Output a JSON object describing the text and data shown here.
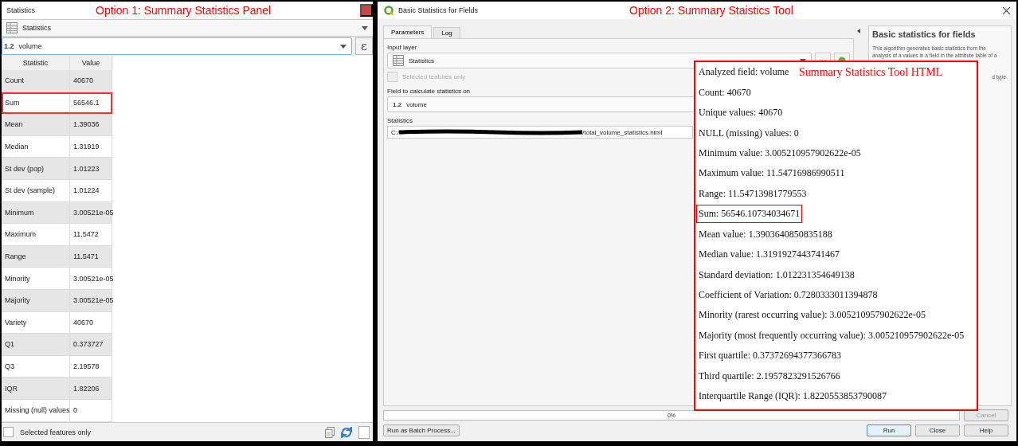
{
  "annotations": {
    "panel_label": "Option 1: Summary Statistics Panel",
    "tool_label": "Option 2: Summary Staistics Tool",
    "html_label": "Summary Statistics Tool HTML"
  },
  "statistics_panel": {
    "title": "Statistics",
    "layer": "Statistics",
    "field": {
      "type_badge": "1.2",
      "value": "volume"
    },
    "expression_button": "ε",
    "table": {
      "columns": [
        "Statistic",
        "Value"
      ],
      "rows": [
        {
          "statistic": "Count",
          "value": "40670",
          "highlighted": false
        },
        {
          "statistic": "Sum",
          "value": "56546.1",
          "highlighted": true
        },
        {
          "statistic": "Mean",
          "value": "1.39036",
          "highlighted": false
        },
        {
          "statistic": "Median",
          "value": "1.31919",
          "highlighted": false
        },
        {
          "statistic": "St dev (pop)",
          "value": "1.01223",
          "highlighted": false
        },
        {
          "statistic": "St dev (sample)",
          "value": "1.01224",
          "highlighted": false
        },
        {
          "statistic": "Minimum",
          "value": "3.00521e-05",
          "highlighted": false
        },
        {
          "statistic": "Maximum",
          "value": "11.5472",
          "highlighted": false
        },
        {
          "statistic": "Range",
          "value": "11.5471",
          "highlighted": false
        },
        {
          "statistic": "Minority",
          "value": "3.00521e-05",
          "highlighted": false
        },
        {
          "statistic": "Majority",
          "value": "3.00521e-05",
          "highlighted": false
        },
        {
          "statistic": "Variety",
          "value": "40670",
          "highlighted": false
        },
        {
          "statistic": "Q1",
          "value": "0.373727",
          "highlighted": false
        },
        {
          "statistic": "Q3",
          "value": "2.19578",
          "highlighted": false
        },
        {
          "statistic": "IQR",
          "value": "1.82206",
          "highlighted": false
        },
        {
          "statistic": "Missing (null) values",
          "value": "0",
          "highlighted": false
        }
      ]
    },
    "selected_features_only": {
      "label": "Selected features only",
      "checked": false
    }
  },
  "dialog": {
    "title": "Basic Statistics for Fields",
    "tabs": [
      {
        "label": "Parameters",
        "selected": true
      },
      {
        "label": "Log",
        "selected": false
      }
    ],
    "input_layer": {
      "label": "Input layer",
      "value": "Statistics"
    },
    "selected_features_only": {
      "label": "Selected features only",
      "checked": false,
      "disabled": true
    },
    "field": {
      "label": "Field to calculate statistics on",
      "type_badge": "1.2",
      "value": "volume"
    },
    "output": {
      "label": "Statistics",
      "path_start": "C:/",
      "path_end": "/total_volume_statistics.html"
    },
    "help": {
      "title": "Basic statistics for fields",
      "lines": [
        "This algorithm generates basic statistics from the",
        "analysis of a values in a field in the attribute table of a"
      ],
      "fragment": "d type."
    },
    "progress": {
      "level": 0,
      "label": "0%"
    },
    "cancel_button": {
      "label": "Cancel",
      "disabled": true
    },
    "batch_button": "Run as Batch Process...",
    "buttons": [
      {
        "label": "Run",
        "default": true
      },
      {
        "label": "Close",
        "default": false
      },
      {
        "label": "Help",
        "default": false
      }
    ]
  },
  "html_report": {
    "lines": [
      {
        "text": "Analyzed field: volume",
        "highlighted": false
      },
      {
        "text": "Count: 40670",
        "highlighted": false
      },
      {
        "text": "Unique values: 40670",
        "highlighted": false
      },
      {
        "text": "NULL (missing) values: 0",
        "highlighted": false
      },
      {
        "text": "Minimum value: 3.005210957902622e-05",
        "highlighted": false
      },
      {
        "text": "Maximum value: 11.54716986990511",
        "highlighted": false
      },
      {
        "text": "Range: 11.54713981779553",
        "highlighted": false
      },
      {
        "text": "Sum: 56546.10734034671",
        "highlighted": true
      },
      {
        "text": "Mean value: 1.3903640850835188",
        "highlighted": false
      },
      {
        "text": "Median value: 1.3191927443741467",
        "highlighted": false
      },
      {
        "text": "Standard deviation: 1.012231354649138",
        "highlighted": false
      },
      {
        "text": "Coefficient of Variation: 0.7280333011394878",
        "highlighted": false
      },
      {
        "text": "Minority (rarest occurring value): 3.005210957902622e-05",
        "highlighted": false
      },
      {
        "text": "Majority (most frequently occurring value): 3.005210957902622e-05",
        "highlighted": false
      },
      {
        "text": "First quartile: 0.37372694377366783",
        "highlighted": false
      },
      {
        "text": "Third quartile: 2.1957823291526766",
        "highlighted": false
      },
      {
        "text": "Interquartile Range (IQR): 1.8220553853790087",
        "highlighted": false
      }
    ]
  }
}
